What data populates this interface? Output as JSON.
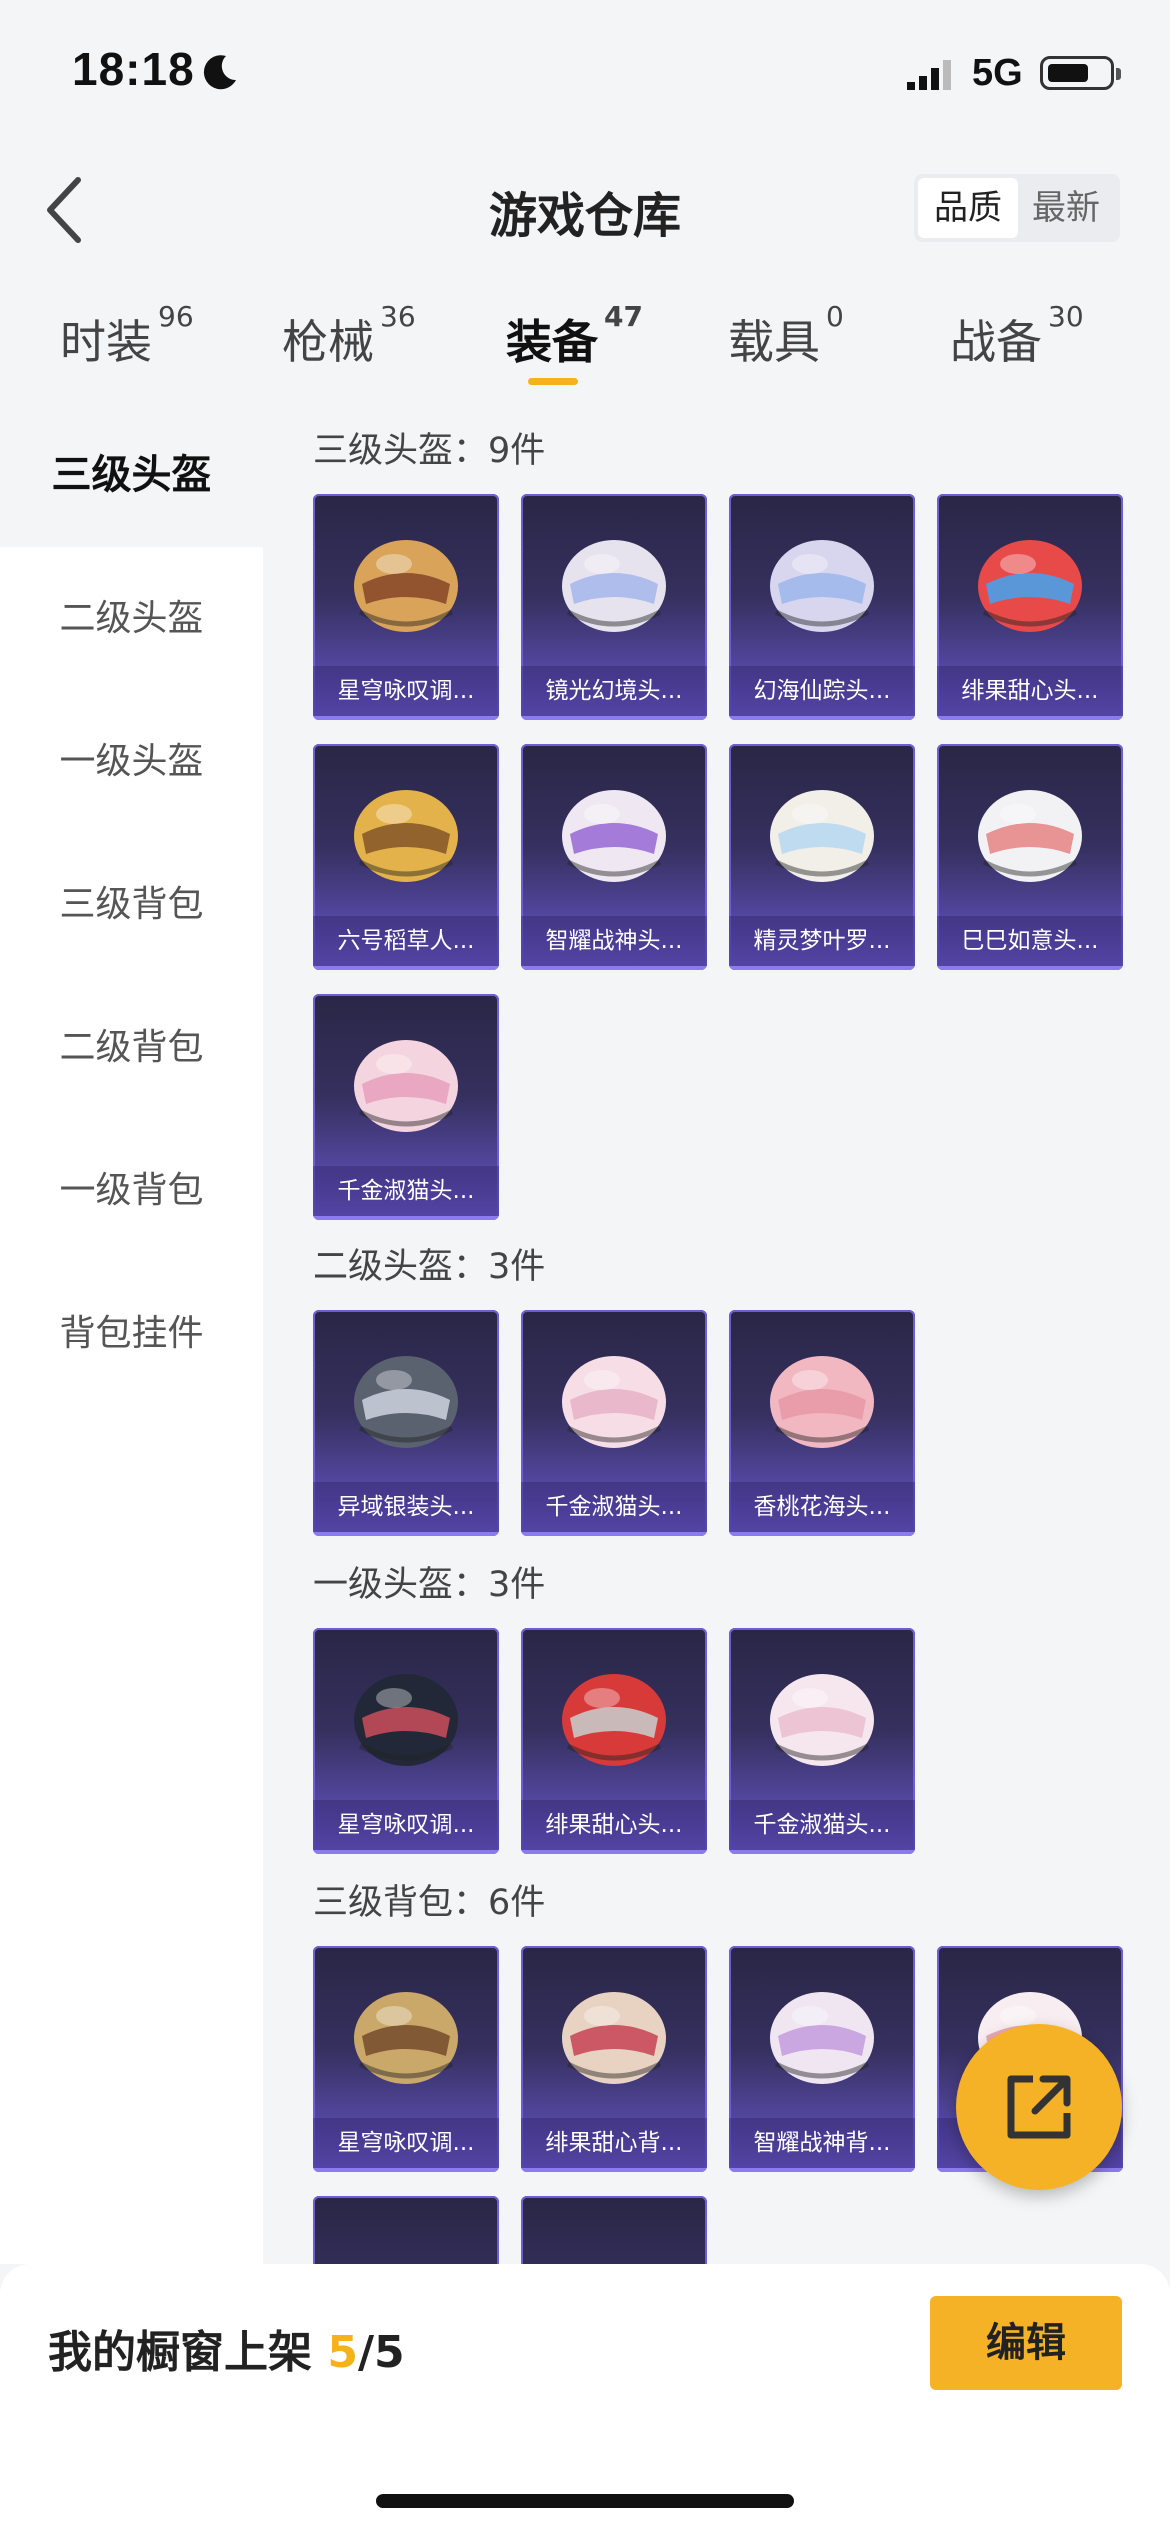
{
  "status_bar": {
    "time": "18:18",
    "network": "5G"
  },
  "header": {
    "title": "游戏仓库",
    "sort_options": [
      "品质",
      "最新"
    ],
    "active_sort": "品质"
  },
  "tabs": [
    {
      "label": "时装",
      "count": "96"
    },
    {
      "label": "枪械",
      "count": "36"
    },
    {
      "label": "装备",
      "count": "47"
    },
    {
      "label": "载具",
      "count": "0"
    },
    {
      "label": "战备",
      "count": "30"
    }
  ],
  "active_tab": "装备",
  "sidebar": {
    "items": [
      "三级头盔",
      "二级头盔",
      "一级头盔",
      "三级背包",
      "二级背包",
      "一级背包",
      "背包挂件"
    ],
    "active": "三级头盔"
  },
  "sections": [
    {
      "title": "三级头盔：9件",
      "items": [
        "星穹咏叹调...",
        "镜光幻境头...",
        "幻海仙踪头...",
        "绯果甜心头...",
        "六号稻草人...",
        "智耀战神头...",
        "精灵梦叶罗...",
        "巳巳如意头...",
        "千金淑猫头..."
      ]
    },
    {
      "title": "二级头盔：3件",
      "items": [
        "异域银装头...",
        "千金淑猫头...",
        "香桃花海头..."
      ]
    },
    {
      "title": "一级头盔：3件",
      "items": [
        "星穹咏叹调...",
        "绯果甜心头...",
        "千金淑猫头..."
      ]
    },
    {
      "title": "三级背包：6件",
      "items": [
        "星穹咏叹调...",
        "绯果甜心背...",
        "智耀战神背...",
        ""
      ]
    }
  ],
  "bottom_bar": {
    "showcase_label": "我的橱窗上架",
    "showcase_current": "5",
    "showcase_total": "/5",
    "edit_label": "编辑"
  },
  "colors": {
    "accent": "#f6b227",
    "card_purple": "#5b4cb0"
  }
}
